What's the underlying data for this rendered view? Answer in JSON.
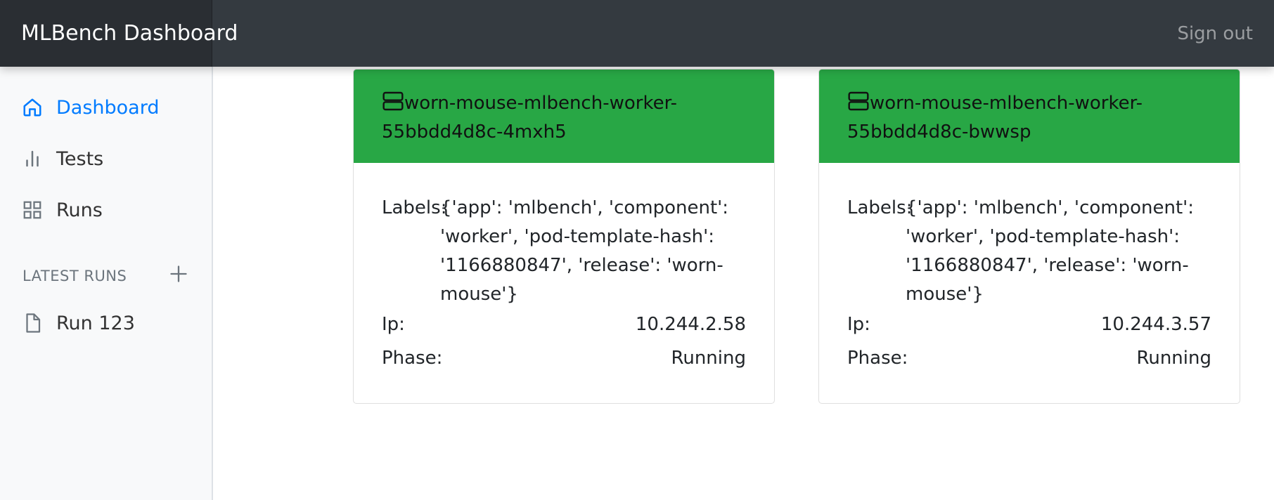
{
  "app": {
    "title": "MLBench Dashboard",
    "signout_label": "Sign out"
  },
  "sidebar": {
    "items": [
      {
        "label": "Dashboard",
        "icon": "home-icon",
        "active": true
      },
      {
        "label": "Tests",
        "icon": "bar-chart-icon",
        "active": false
      },
      {
        "label": "Runs",
        "icon": "grid-icon",
        "active": false
      }
    ],
    "latest_runs_heading": "LATEST RUNS",
    "add_icon": "plus-icon",
    "runs": [
      {
        "label": "Run 123",
        "icon": "file-icon"
      }
    ]
  },
  "colors": {
    "navbar": "#343a40",
    "brand_bg": "#2a2e33",
    "accent": "#007bff",
    "card_header": "#28a745"
  },
  "workers": [
    {
      "icon": "server-icon",
      "name": "worn-mouse-mlbench-worker-55bbdd4d8c-4mxh5",
      "labels_key": "Labels:",
      "labels_value": "{'app': 'mlbench', 'component': 'worker', 'pod-template-hash': '1166880847', 'release': 'worn-mouse'}",
      "ip_key": "Ip:",
      "ip_value": "10.244.2.58",
      "phase_key": "Phase:",
      "phase_value": "Running"
    },
    {
      "icon": "server-icon",
      "name": "worn-mouse-mlbench-worker-55bbdd4d8c-bwwsp",
      "labels_key": "Labels:",
      "labels_value": "{'app': 'mlbench', 'component': 'worker', 'pod-template-hash': '1166880847', 'release': 'worn-mouse'}",
      "ip_key": "Ip:",
      "ip_value": "10.244.3.57",
      "phase_key": "Phase:",
      "phase_value": "Running"
    }
  ]
}
